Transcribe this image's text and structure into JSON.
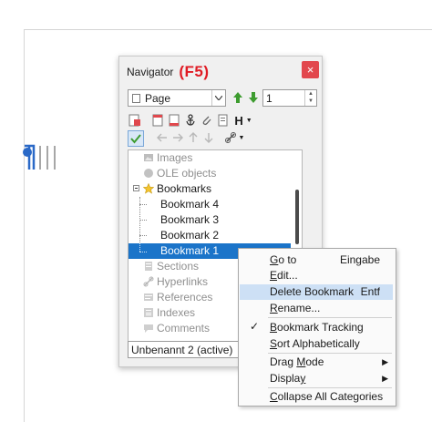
{
  "navigator": {
    "title": "Navigator",
    "shortcut": "(F5)",
    "close_symbol": "×",
    "category_select": "Page",
    "page_number": "1",
    "tree": {
      "images": "Images",
      "ole": "OLE objects",
      "bookmarks": "Bookmarks",
      "bookmark_items": [
        "Bookmark 4",
        "Bookmark 3",
        "Bookmark 2",
        "Bookmark 1"
      ],
      "sections": "Sections",
      "hyperlinks": "Hyperlinks",
      "references": "References",
      "indexes": "Indexes",
      "comments": "Comments"
    },
    "document_select": "Unbenannt 2 (active)",
    "toolbar_heading_label": "H"
  },
  "context_menu": {
    "goto": {
      "first": "G",
      "rest": "o to",
      "shortcut": "Eingabe"
    },
    "edit": {
      "first": "E",
      "rest": "dit..."
    },
    "delete": {
      "label": "Delete Bookmark",
      "shortcut": "Entf"
    },
    "rename": {
      "first": "R",
      "rest": "ename..."
    },
    "tracking": {
      "check": "✓",
      "first": "B",
      "rest": "ookmark Tracking"
    },
    "sort": {
      "first": "S",
      "rest": "ort Alphabetically"
    },
    "drag": {
      "pre": "Drag ",
      "u": "M",
      "rest": "ode"
    },
    "display": {
      "pre": "Displa",
      "u": "y",
      "rest": ""
    },
    "collapse": {
      "first": "C",
      "rest": "ollapse All Categories"
    },
    "submenu_arrow": "▶"
  },
  "colors": {
    "selection": "#1b74c9",
    "menu_highlight": "#cde0f5",
    "close_button": "#e2474d",
    "shortcut_hint": "#e01b24"
  }
}
